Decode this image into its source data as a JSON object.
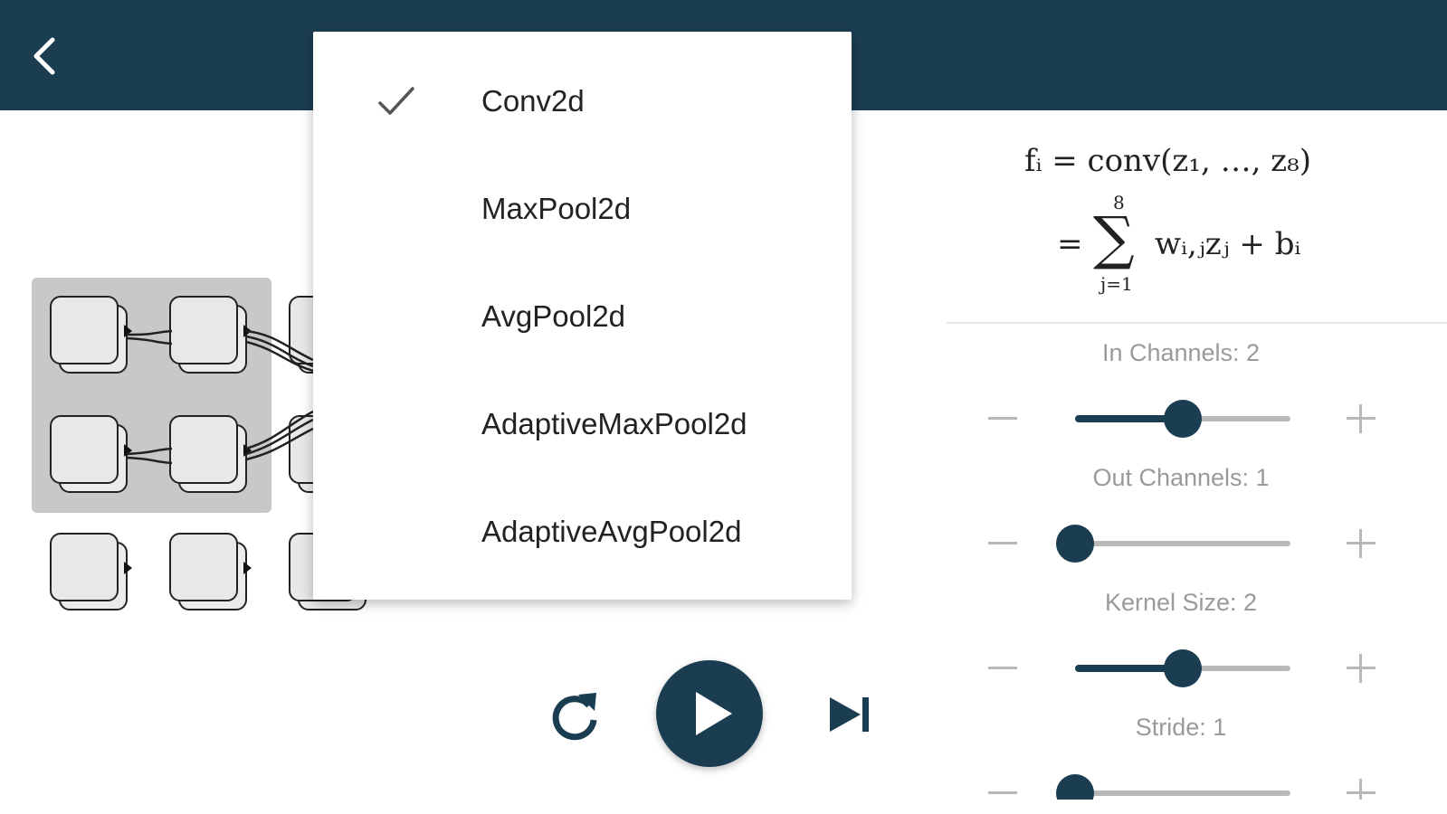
{
  "header": {
    "back_icon": "chevron-left-icon"
  },
  "layer_menu": {
    "selected": "Conv2d",
    "items": [
      {
        "label": "Conv2d",
        "checked": true
      },
      {
        "label": "MaxPool2d",
        "checked": false
      },
      {
        "label": "AvgPool2d",
        "checked": false
      },
      {
        "label": "AdaptiveMaxPool2d",
        "checked": false
      },
      {
        "label": "AdaptiveAvgPool2d",
        "checked": false
      }
    ]
  },
  "formula": {
    "line1": "fᵢ = conv(z₁, …, z₈)",
    "line2_prefix": "=",
    "sigma": "∑",
    "upper": "8",
    "lower": "j=1",
    "line2_rest": "wᵢ,ⱼzⱼ + bᵢ"
  },
  "params": [
    {
      "label": "In Channels: 2",
      "value": 2,
      "level": 0.5
    },
    {
      "label": "Out Channels: 1",
      "value": 1,
      "level": 0.0
    },
    {
      "label": "Kernel Size: 2",
      "value": 2,
      "level": 0.5
    },
    {
      "label": "Stride: 1",
      "value": 1,
      "level": 0.0
    }
  ],
  "controls": {
    "replay_icon": "replay-icon",
    "play_icon": "play-icon",
    "next_icon": "skip-next-icon"
  },
  "colors": {
    "primary": "#1b3d52",
    "node_fill": "#e8e8e8",
    "group_bg": "#c8c8c8",
    "muted_text": "#9a9a9a"
  }
}
